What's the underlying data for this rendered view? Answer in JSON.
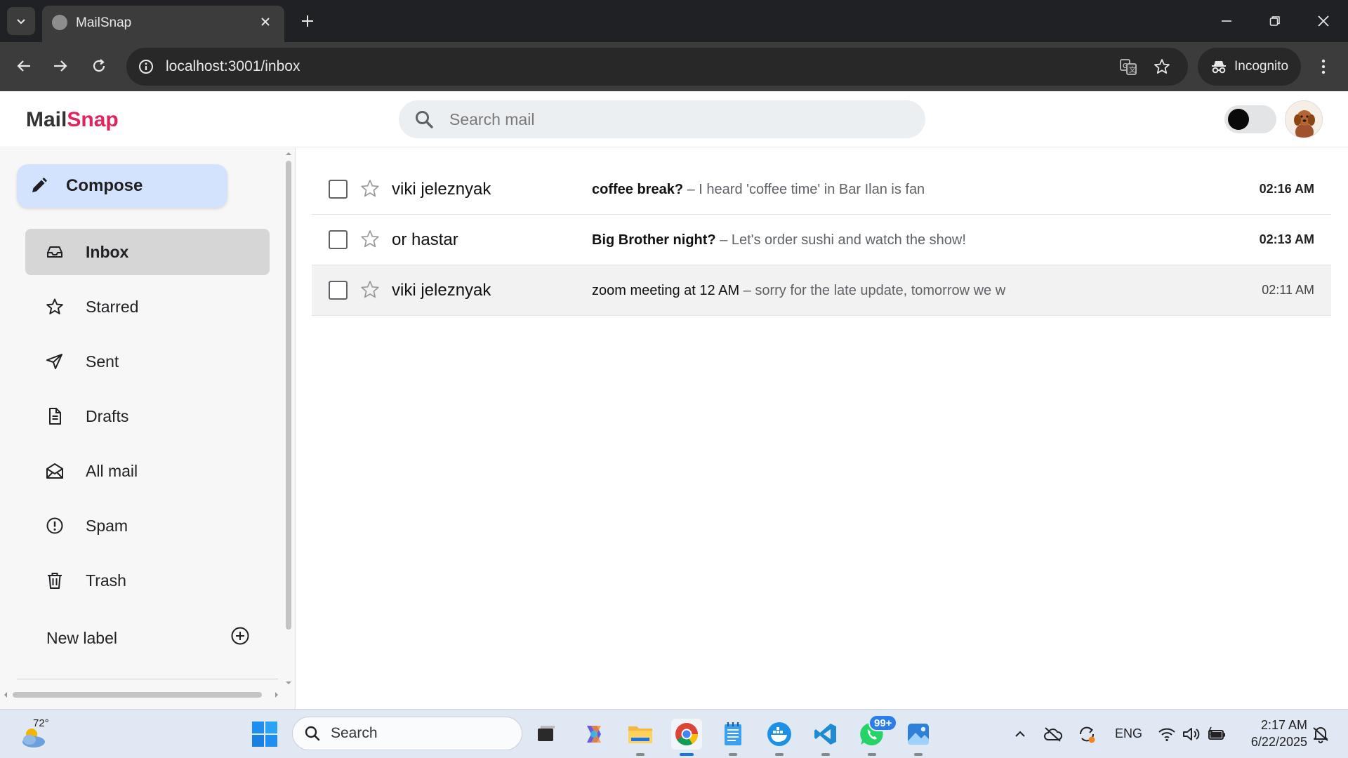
{
  "browser": {
    "tab_title": "MailSnap",
    "url": "localhost:3001/inbox",
    "incognito_label": "Incognito"
  },
  "app": {
    "logo_part1": "Mail",
    "logo_part2": "Snap",
    "logo_accent_color": "#e0245e",
    "search_placeholder": "Search mail"
  },
  "sidebar": {
    "compose_label": "Compose",
    "items": [
      {
        "label": "Inbox",
        "icon": "inbox-icon",
        "active": true
      },
      {
        "label": "Starred",
        "icon": "star-icon"
      },
      {
        "label": "Sent",
        "icon": "send-icon"
      },
      {
        "label": "Drafts",
        "icon": "draft-icon"
      },
      {
        "label": "All mail",
        "icon": "all-mail-icon"
      },
      {
        "label": "Spam",
        "icon": "spam-icon"
      },
      {
        "label": "Trash",
        "icon": "trash-icon"
      }
    ],
    "new_label": "New label"
  },
  "mails": [
    {
      "sender": "viki jeleznyak",
      "subject": "coffee break?",
      "snippet": " – I heard 'coffee time' in Bar Ilan is fan",
      "time": "02:16 AM",
      "unread": true
    },
    {
      "sender": "or hastar",
      "subject": "Big Brother night?",
      "snippet": " – Let's order sushi and watch the show!",
      "time": "02:13 AM",
      "unread": true
    },
    {
      "sender": "viki jeleznyak",
      "subject": "zoom meeting at 12 AM",
      "snippet": " – sorry for the late update, tomorrow we w",
      "time": "02:11 AM",
      "unread": false
    }
  ],
  "taskbar": {
    "temperature": "72°",
    "search_label": "Search",
    "whatsapp_badge": "99+",
    "language": "ENG",
    "time": "2:17 AM",
    "date": "6/22/2025"
  }
}
